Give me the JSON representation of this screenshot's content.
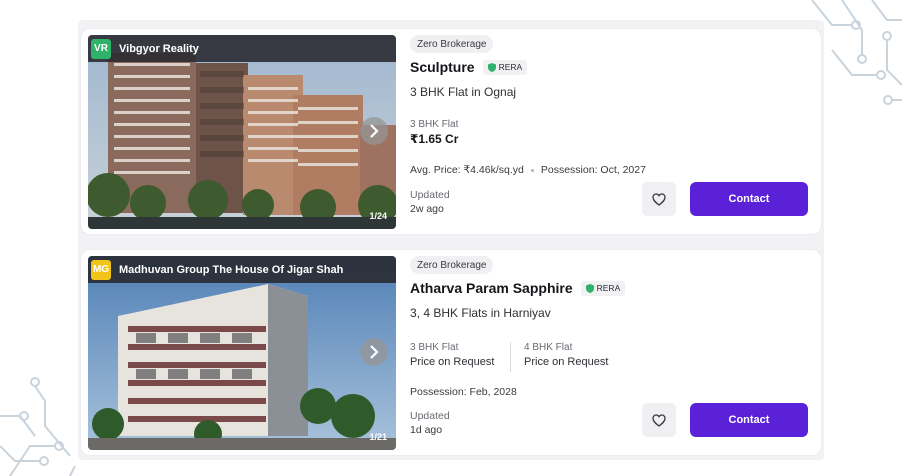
{
  "listings": [
    {
      "builder_initials": "VR",
      "builder_name": "Vibgyor Reality",
      "builder_color": "#2fb36b",
      "image_counter": "1/24",
      "badge": "Zero Brokerage",
      "title": "Sculpture",
      "rera": "RERA",
      "subtitle": "3 BHK Flat in Ognaj",
      "configs": [
        {
          "label": "3 BHK Flat",
          "price": "₹1.65 Cr"
        }
      ],
      "avg_price": "Avg. Price: ₹4.46k/sq.yd",
      "possession": "Possession: Oct, 2027",
      "updated_label": "Updated",
      "updated_value": "2w ago",
      "contact_label": "Contact"
    },
    {
      "builder_initials": "MG",
      "builder_name": "Madhuvan Group The House Of Jigar Shah",
      "builder_color": "#f0c419",
      "image_counter": "1/21",
      "badge": "Zero Brokerage",
      "title": "Atharva Param Sapphire",
      "rera": "RERA",
      "subtitle": "3, 4 BHK Flats in Harniyav",
      "configs": [
        {
          "label": "3 BHK Flat",
          "price": "Price on Request"
        },
        {
          "label": "4 BHK Flat",
          "price": "Price on Request"
        }
      ],
      "possession": "Possession: Feb, 2028",
      "updated_label": "Updated",
      "updated_value": "1d ago",
      "contact_label": "Contact"
    }
  ],
  "colors": {
    "accent": "#5b21d9",
    "rera_shield": "#2fb36b"
  },
  "icons": [
    "chevron-right-icon",
    "heart-icon",
    "shield-icon"
  ]
}
